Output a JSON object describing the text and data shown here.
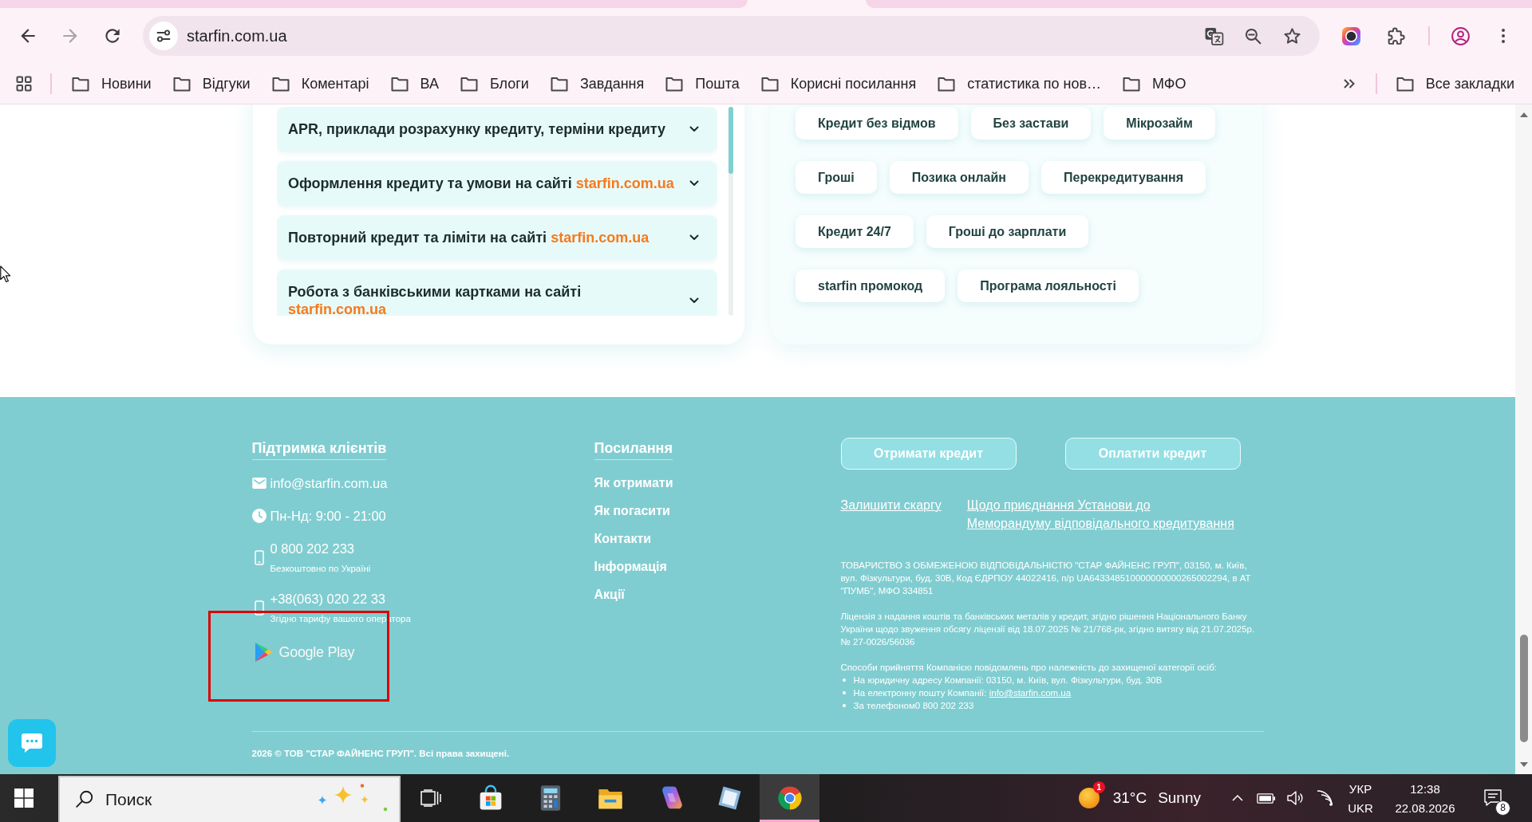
{
  "browser": {
    "navigation": [
      {
        "kind": "back",
        "disabled": false
      },
      {
        "kind": "forward",
        "disabled": true
      },
      {
        "kind": "reload",
        "disabled": false
      }
    ],
    "url": "starfin.com.ua",
    "bookmarks": [
      "Новини",
      "Відгуки",
      "Коментарі",
      "ВА",
      "Блоги",
      "Завдання",
      "Пошта",
      "Корисні посилання",
      "статистика по нов…",
      "МФО"
    ],
    "all_bookmarks": "Все закладки"
  },
  "faq": {
    "items": [
      {
        "text": "APR, приклади розрахунку кредиту, терміни кредиту",
        "expanded": false
      },
      {
        "text": "Оформлення кредиту та умови на сайті",
        "link": "starfin.com.ua",
        "expanded": false
      },
      {
        "text": "Повторний кредит та ліміти на сайті",
        "link": "starfin.com.ua",
        "expanded": false
      },
      {
        "text": "Робота з банківськими картками на сайті",
        "link": "starfin.com.ua",
        "expanded": false
      }
    ]
  },
  "tags": {
    "rows": [
      [
        "Кредит без відмов",
        "Без застави",
        "Мікрозайм"
      ],
      [
        "Гроші",
        "Позика онлайн",
        "Перекредитування"
      ],
      [
        "Кредит 24/7",
        "Гроші до зарплати"
      ],
      [
        "starfin промокод",
        "Програма лояльності"
      ]
    ]
  },
  "footer": {
    "support": {
      "title": "Підтримка клієнтів",
      "contacts": [
        {
          "kind": "email",
          "value": "info@starfin.com.ua"
        },
        {
          "kind": "hours",
          "value": "Пн-Нд: 9:00 - 21:00"
        },
        {
          "kind": "phone",
          "value": "0 800 202 233",
          "note": "Безкоштовно по Україні"
        },
        {
          "kind": "phone",
          "value": "+38(063) 020 22 33",
          "note": "Згідно тарифу вашого оператора"
        }
      ],
      "app_store": "Google Play"
    },
    "links": {
      "title": "Посилання",
      "items": [
        "Як отримати",
        "Як погасити",
        "Контакти",
        "Інформація",
        "Акції"
      ]
    },
    "buttons": [
      "Отримати кредит",
      "Оплатити кредит"
    ],
    "policy_links": [
      {
        "lines": [
          "Залишити скаргу"
        ]
      },
      {
        "lines": [
          "Щодо приєднання Установи до",
          "Меморандуму відповідального кредитування"
        ]
      }
    ],
    "legal": [
      "ТОВАРИСТВО З ОБМЕЖЕНОЮ ВІДПОВІДАЛЬНІСТЮ \"СТАР ФАЙНЕНС ГРУП\", 03150, м. Київ, вул. Фізкультури, буд. 30В, Код ЄДРПОУ 44022416, п/р UA643348510000000000265002294, в АТ \"ПУМБ\", МФО 334851",
      "Ліцензія з надання коштів та банківських металів у кредит, згідно рішення Національного Банку України щодо звуження обсягу ліцензії від 18.07.2025 № 21/768-рк, згідно витягу від 21.07.2025р. № 27-0026/56036"
    ],
    "notice": {
      "intro": "Способи прийняття Компанією повідомлень про належність до захищеної категорії осіб:",
      "items": [
        {
          "text": "На юридичну адресу Компанії: 03150, м. Київ, вул. Фізкультури, буд. 30В"
        },
        {
          "text": "На електронну пошту Компанії:",
          "link": "info@starfin.com.ua"
        },
        {
          "text": "За телефоном0 800 202 233"
        }
      ]
    },
    "copyright": "2026 © ТОВ \"СТАР ФАЙНЕНС ГРУП\". Всі права захищені."
  },
  "taskbar": {
    "search": {
      "placeholder": "Поиск"
    },
    "apps": [
      {
        "kind": "store",
        "selected": false
      },
      {
        "kind": "calculator",
        "selected": false
      },
      {
        "kind": "files",
        "selected": false
      },
      {
        "kind": "assistant",
        "selected": false
      },
      {
        "kind": "notes",
        "selected": false
      },
      {
        "kind": "browser",
        "selected": true
      }
    ],
    "weather": {
      "temperature": "31°C",
      "condition": "Sunny",
      "badge": "1"
    },
    "language": {
      "short": "УКР",
      "layout": "UKR"
    },
    "time": "12:38",
    "date": "22.08.2026",
    "notifications": "8"
  }
}
